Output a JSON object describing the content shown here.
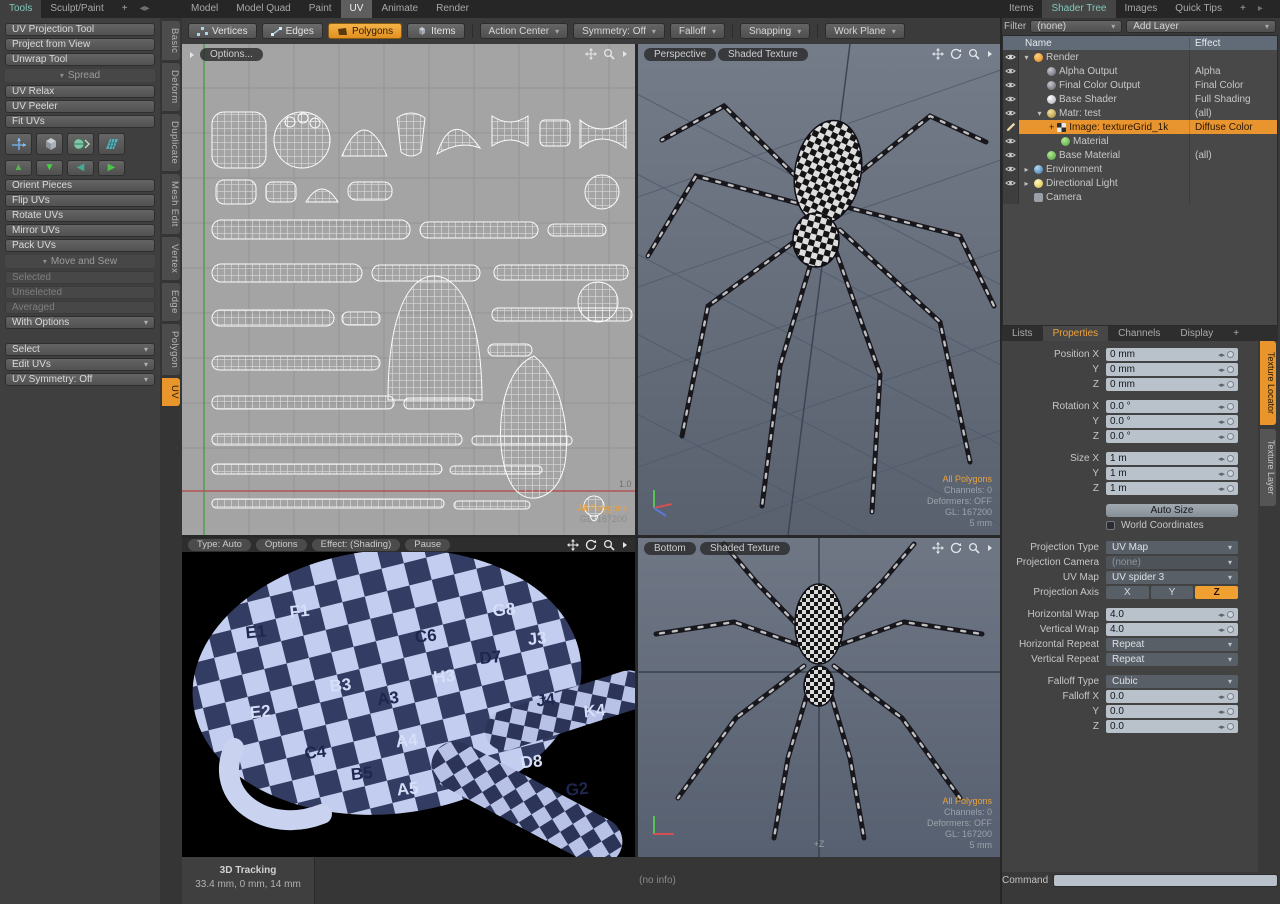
{
  "top_bar": {
    "left_tabs": [
      {
        "label": "Tools",
        "active": true
      },
      {
        "label": "Sculpt/Paint",
        "active": false
      },
      {
        "label": "+",
        "active": false
      }
    ],
    "center_tabs": [
      {
        "label": "Model",
        "active": false
      },
      {
        "label": "Model Quad",
        "active": false
      },
      {
        "label": "Paint",
        "active": false
      },
      {
        "label": "UV",
        "active": true
      },
      {
        "label": "Animate",
        "active": false
      },
      {
        "label": "Render",
        "active": false
      }
    ],
    "right_tabs": [
      {
        "label": "Items",
        "active": false
      },
      {
        "label": "Shader Tree",
        "active": true
      },
      {
        "label": "Images",
        "active": false
      },
      {
        "label": "Quick Tips",
        "active": false
      },
      {
        "label": "+",
        "active": false
      }
    ]
  },
  "tool_panel": {
    "top_buttons": [
      "UV Projection Tool",
      "Project from View",
      "Unwrap Tool"
    ],
    "spread_header": "Spread",
    "spread_buttons": [
      "UV Relax",
      "UV Peeler",
      "Fit UVs"
    ],
    "arrow_buttons": [
      {
        "name": "move-up",
        "glyph": "▲"
      },
      {
        "name": "move-down",
        "glyph": "▼"
      },
      {
        "name": "move-left",
        "glyph": "◀"
      },
      {
        "name": "move-right",
        "glyph": "▶"
      }
    ],
    "action_buttons": [
      "Orient Pieces",
      "Flip UVs",
      "Rotate UVs",
      "Mirror UVs",
      "Pack UVs"
    ],
    "move_sew_header": "Move and Sew",
    "disabled_items": [
      "Selected",
      "Unselected",
      "Averaged"
    ],
    "with_options": "With Options",
    "bottom_dropdowns": [
      "Select",
      "Edit UVs",
      "UV Symmetry: Off"
    ]
  },
  "side_tabs": [
    "Basic",
    "Deform",
    "Duplicate",
    "Mesh Edit",
    "Vertex",
    "Edge",
    "Polygon",
    "UV"
  ],
  "main_toolbar": {
    "modes": [
      {
        "label": "Vertices",
        "active": false
      },
      {
        "label": "Edges",
        "active": false
      },
      {
        "label": "Polygons",
        "active": true
      },
      {
        "label": "Items",
        "active": false
      }
    ],
    "dropdowns": [
      "Action Center",
      "Symmetry: Off",
      "Falloff",
      "Snapping",
      "Work Plane"
    ]
  },
  "uv_viewport": {
    "options_button": "Options...",
    "selection": "All Polygons",
    "gl": "GL: 167200",
    "axis_label": "1.0"
  },
  "perspective_viewport": {
    "view_selector": "Perspective",
    "shading_selector": "Shaded Texture",
    "selection": "All Polygons",
    "channels": "Channels: 0",
    "deformers": "Deformers: OFF",
    "gl": "GL: 167200",
    "scale": "5 mm"
  },
  "preview_viewport": {
    "buttons": [
      "Type: Auto",
      "Options",
      "Effect: (Shading)",
      "Pause"
    ],
    "labels": [
      "E1",
      "F1",
      "C6",
      "G8",
      "B3",
      "A3",
      "H3",
      "D7",
      "J3",
      "A4",
      "J4",
      "K4",
      "B5",
      "A5",
      "C4",
      "G2",
      "D8",
      "E2"
    ]
  },
  "bottom_viewport": {
    "view_selector": "Bottom",
    "shading_selector": "Shaded Texture",
    "selection": "All Polygons",
    "channels": "Channels: 0",
    "deformers": "Deformers: OFF",
    "gl": "GL: 167200",
    "scale": "5 mm",
    "axis_label": "+Z"
  },
  "shader_tree": {
    "filter_label": "Filter",
    "filter_value": "(none)",
    "add_layer_button": "Add Layer",
    "columns": {
      "name": "Name",
      "effect": "Effect"
    },
    "rows": [
      {
        "name": "Render",
        "effect": "",
        "expander": "▾",
        "selected": false
      },
      {
        "name": "Alpha Output",
        "effect": "Alpha",
        "expander": "",
        "selected": false
      },
      {
        "name": "Final Color Output",
        "effect": "Final Color",
        "expander": "",
        "selected": false
      },
      {
        "name": "Base Shader",
        "effect": "Full Shading",
        "expander": "",
        "selected": false
      },
      {
        "name": "Matr: test",
        "effect": "(all)",
        "expander": "▾",
        "selected": false
      },
      {
        "name": "Image: textureGrid_1k",
        "effect": "Diffuse Color",
        "expander": "",
        "prefix": "+",
        "selected": true
      },
      {
        "name": "Material",
        "effect": "",
        "expander": "",
        "selected": false
      },
      {
        "name": "Base Material",
        "effect": "(all)",
        "expander": "",
        "selected": false
      },
      {
        "name": "Environment",
        "effect": "",
        "expander": "▸",
        "selected": false
      },
      {
        "name": "Directional Light",
        "effect": "",
        "expander": "▸",
        "selected": false
      },
      {
        "name": "Camera",
        "effect": "",
        "expander": "",
        "selected": false
      }
    ]
  },
  "properties_panel": {
    "tabs": [
      {
        "label": "Lists",
        "active": false
      },
      {
        "label": "Properties",
        "active": true
      },
      {
        "label": "Channels",
        "active": false
      },
      {
        "label": "Display",
        "active": false
      },
      {
        "label": "+",
        "active": false
      }
    ],
    "transform_fields": [
      {
        "label": "Position X",
        "value": "0 mm"
      },
      {
        "label": "Y",
        "value": "0 mm"
      },
      {
        "label": "Z",
        "value": "0 mm"
      },
      {
        "label": "Rotation X",
        "value": "0.0 °"
      },
      {
        "label": "Y",
        "value": "0.0 °"
      },
      {
        "label": "Z",
        "value": "0.0 °"
      },
      {
        "label": "Size X",
        "value": "1 m"
      },
      {
        "label": "Y",
        "value": "1 m"
      },
      {
        "label": "Z",
        "value": "1 m"
      }
    ],
    "auto_size_button": "Auto Size",
    "world_coordinates_label": "World Coordinates",
    "world_coordinates_checked": false,
    "projection_fields": [
      {
        "label": "Projection Type",
        "value": "UV Map"
      },
      {
        "label": "Projection Camera",
        "value": "(none)"
      },
      {
        "label": "UV Map",
        "value": "UV spider 3"
      }
    ],
    "projection_axis": {
      "label": "Projection Axis",
      "options": [
        "X",
        "Y",
        "Z"
      ],
      "selected": "Z"
    },
    "wrap_fields": [
      {
        "label": "Horizontal Wrap",
        "value": "4.0"
      },
      {
        "label": "Vertical Wrap",
        "value": "4.0"
      },
      {
        "label": "Horizontal Repeat",
        "value": "Repeat"
      },
      {
        "label": "Vertical Repeat",
        "value": "Repeat"
      }
    ],
    "falloff_fields": [
      {
        "label": "Falloff Type",
        "value": "Cubic"
      },
      {
        "label": "Falloff X",
        "value": "0.0"
      },
      {
        "label": "Y",
        "value": "0.0"
      },
      {
        "label": "Z",
        "value": "0.0"
      }
    ]
  },
  "right_edge_tabs": [
    {
      "label": "Texture Locator",
      "active": true
    },
    {
      "label": "Texture Layer",
      "active": false
    }
  ],
  "status_bar": {
    "tracking_title": "3D Tracking",
    "tracking_coords": "33.4 mm, 0 mm, 14 mm",
    "info": "(no info)",
    "command_label": "Command"
  },
  "icons": {
    "pan-icon": "cross-arrows",
    "orbit-icon": "circular-arrow",
    "zoom-icon": "magnifier",
    "menu-arrow-icon": "▸",
    "eye-icon": "visibility-eye",
    "pencil-icon": "edit-pencil",
    "dropdown-caret": "▾"
  }
}
